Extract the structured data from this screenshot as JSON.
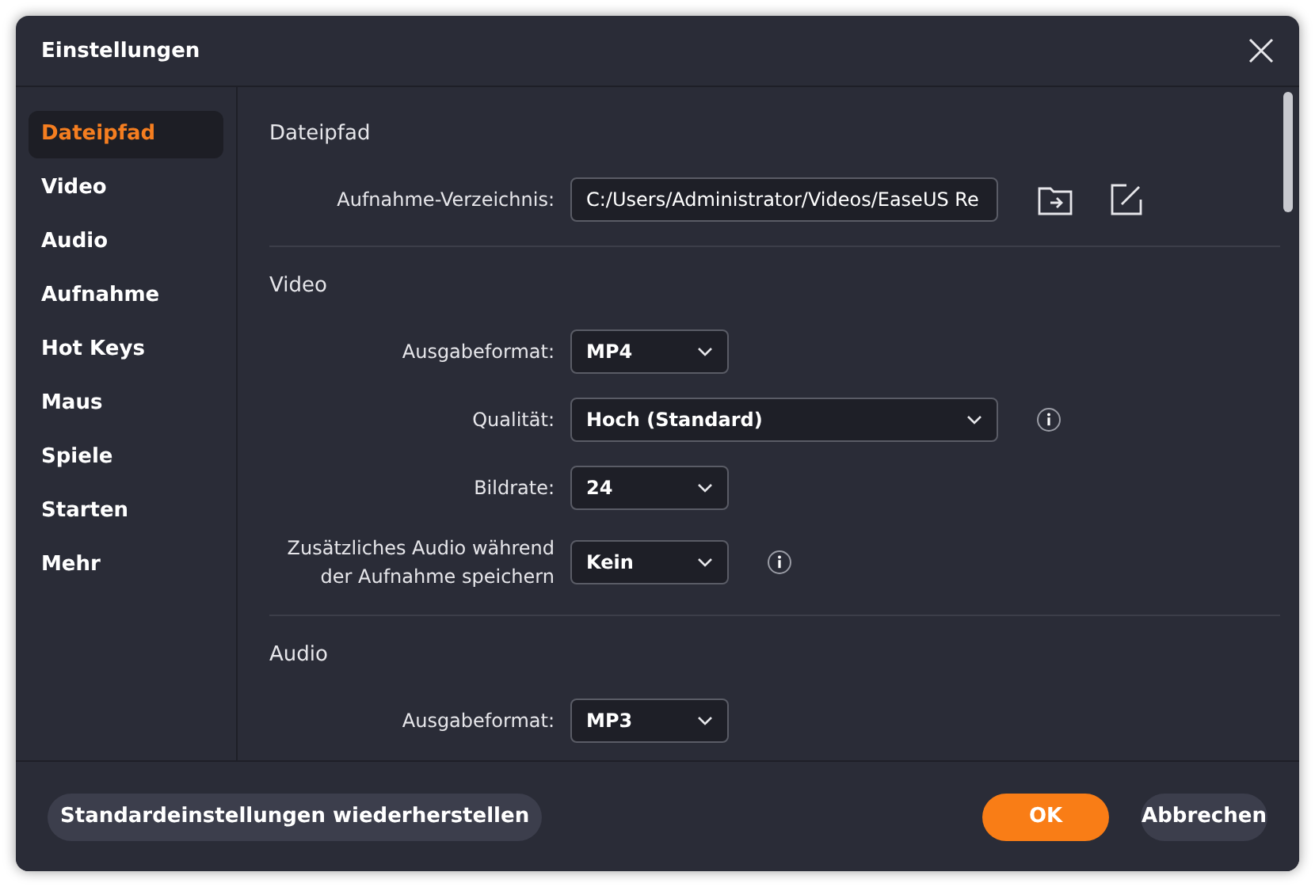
{
  "window": {
    "title": "Einstellungen"
  },
  "sidebar": {
    "items": [
      {
        "label": "Dateipfad",
        "selected": true
      },
      {
        "label": "Video",
        "selected": false
      },
      {
        "label": "Audio",
        "selected": false
      },
      {
        "label": "Aufnahme",
        "selected": false
      },
      {
        "label": "Hot Keys",
        "selected": false
      },
      {
        "label": "Maus",
        "selected": false
      },
      {
        "label": "Spiele",
        "selected": false
      },
      {
        "label": "Starten",
        "selected": false
      },
      {
        "label": "Mehr",
        "selected": false
      }
    ]
  },
  "sections": [
    {
      "title": "Dateipfad",
      "rows": [
        {
          "kind": "path",
          "label": "Aufnahme-Verzeichnis:",
          "value": "C:/Users/Administrator/Videos/EaseUS Re"
        }
      ]
    },
    {
      "title": "Video",
      "rows": [
        {
          "kind": "select",
          "label": "Ausgabeformat:",
          "value": "MP4",
          "info": false
        },
        {
          "kind": "wide-select",
          "label": "Qualität:",
          "value": "Hoch (Standard)",
          "info": true
        },
        {
          "kind": "select",
          "label": "Bildrate:",
          "value": "24",
          "info": false
        },
        {
          "kind": "select",
          "label": "Zusätzliches Audio während der Aufnahme speichern",
          "value": "Kein",
          "info": true
        }
      ]
    },
    {
      "title": "Audio",
      "rows": [
        {
          "kind": "select",
          "label": "Ausgabeformat:",
          "value": "MP3",
          "info": false
        }
      ]
    }
  ],
  "footer": {
    "restore_button": "Standardeinstellungen wiederherstellen",
    "ok_button": "OK",
    "cancel_button": "Abbrechen"
  }
}
